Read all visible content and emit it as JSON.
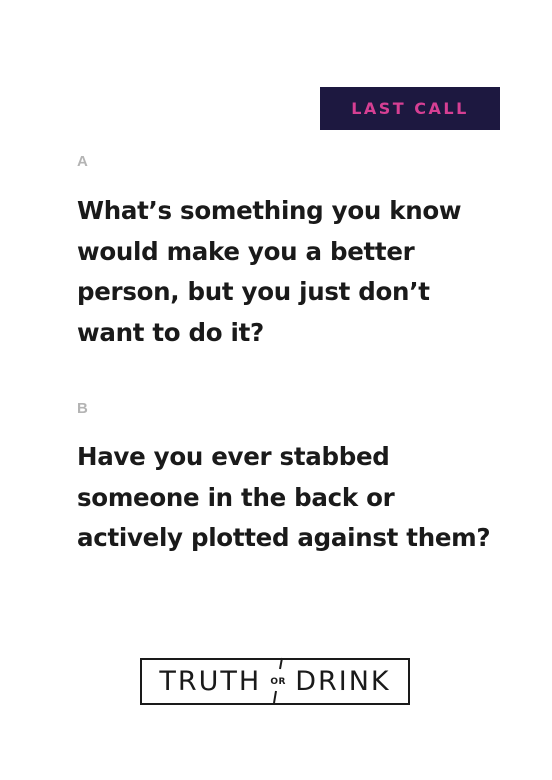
{
  "badge": {
    "label": "LAST CALL",
    "background_color": "#1d1840",
    "text_color": "#d63f93"
  },
  "questions": [
    {
      "letter": "A",
      "text": "What’s something you know would make you a better person, but you just don’t want to do it?"
    },
    {
      "letter": "B",
      "text": "Have you ever stabbed someone in the back or actively plotted against them?"
    }
  ],
  "logo": {
    "word_left": "TRUTH",
    "word_middle": "OR",
    "word_right": "DRINK"
  }
}
